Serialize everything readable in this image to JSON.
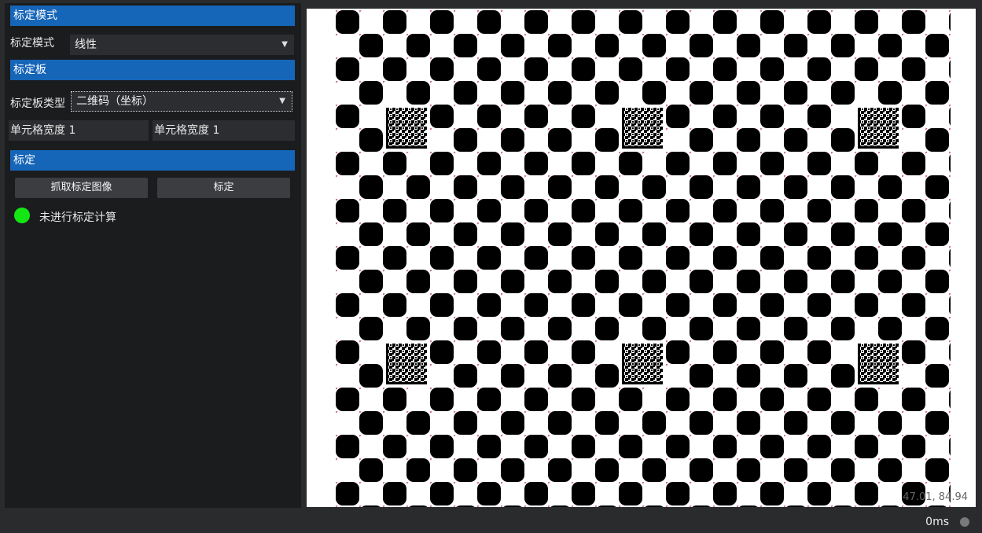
{
  "sections": {
    "mode_header": "标定模式",
    "board_header": "标定板",
    "calib_header": "标定"
  },
  "mode": {
    "label": "标定模式",
    "value": "线性"
  },
  "board": {
    "type_label": "标定板类型",
    "type_value": "二维码（坐标）",
    "cell_width_1": "单元格宽度 1",
    "cell_width_2": "单元格宽度 1"
  },
  "buttons": {
    "capture": "抓取标定图像",
    "calibrate": "标定"
  },
  "status_text": "未进行标定计算",
  "viewer": {
    "coords": "47.01, 84.94"
  },
  "statusbar": {
    "time": "0ms"
  },
  "colors": {
    "accent": "#1565b8",
    "status_ok": "#14e614"
  }
}
